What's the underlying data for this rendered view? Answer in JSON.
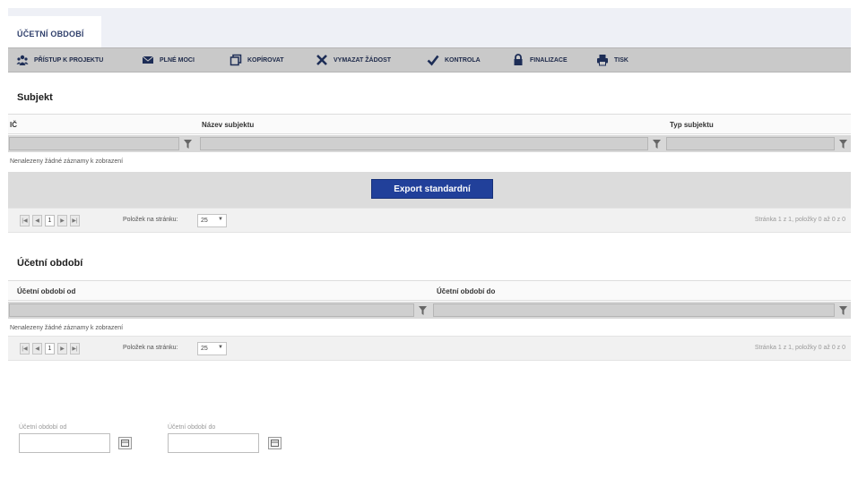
{
  "tab": {
    "label": "ÚČETNÍ OBDOBÍ"
  },
  "toolbar": {
    "items": [
      {
        "label": "PŘÍSTUP K PROJEKTU",
        "icon": "people-icon"
      },
      {
        "label": "PLNÉ MOCI",
        "icon": "envelope-icon"
      },
      {
        "label": "KOPÍROVAT",
        "icon": "copy-icon"
      },
      {
        "label": "VYMAZAT ŽÁDOST",
        "icon": "x-icon"
      },
      {
        "label": "KONTROLA",
        "icon": "check-icon"
      },
      {
        "label": "FINALIZACE",
        "icon": "lock-icon"
      },
      {
        "label": "TISK",
        "icon": "printer-icon"
      }
    ]
  },
  "subjekt": {
    "title": "Subjekt",
    "columns": [
      "IČ",
      "Název subjektu",
      "Typ subjektu"
    ],
    "empty_message": "Nenalezeny žádné záznamy k zobrazení",
    "export_label": "Export standardní",
    "pager": {
      "current_page": "1",
      "per_page_label": "Položek na stránku:",
      "per_page_value": "25",
      "info": "Stránka 1 z 1, položky 0 až 0 z 0"
    }
  },
  "obdobi": {
    "title": "Účetní období",
    "columns": [
      "Účetní období od",
      "Účetní období do"
    ],
    "empty_message": "Nenalezeny žádné záznamy k zobrazení",
    "pager": {
      "current_page": "1",
      "per_page_label": "Položek na stránku:",
      "per_page_value": "25",
      "info": "Stránka 1 z 1, položky 0 až 0 z 0"
    }
  },
  "form": {
    "from_label": "Účetní období od",
    "to_label": "Účetní období do"
  },
  "colors": {
    "accent": "#21409a",
    "toolbar_bg": "#c9c9c9",
    "tab_text": "#2f3f6b"
  }
}
